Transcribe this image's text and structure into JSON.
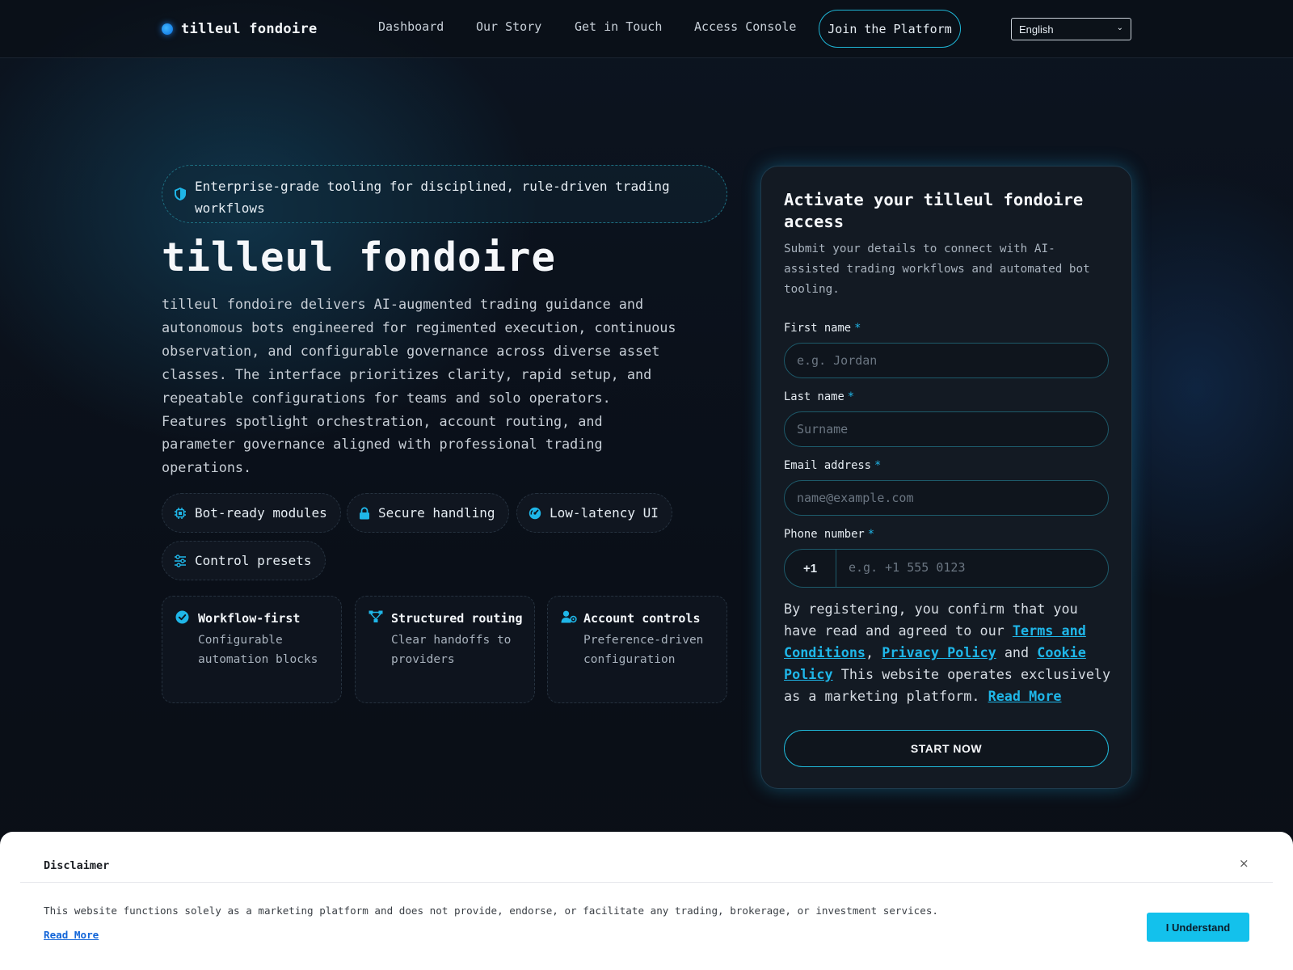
{
  "brand": {
    "name": "tilleul fondoire"
  },
  "nav": {
    "links": [
      "Dashboard",
      "Our Story",
      "Get in Touch",
      "Access Console"
    ],
    "join_label": "Join the Platform",
    "language": "English"
  },
  "hero": {
    "tagline": "Enterprise-grade tooling for disciplined, rule-driven trading workflows",
    "title": "tilleul fondoire",
    "description": "tilleul fondoire delivers AI-augmented trading guidance and autonomous bots engineered for regimented execution, continuous observation, and configurable governance across diverse asset classes. The interface prioritizes clarity, rapid setup, and repeatable configurations for teams and solo operators. Features spotlight orchestration, account routing, and parameter governance aligned with professional trading operations.",
    "pills": [
      {
        "label": "Bot-ready modules",
        "icon": "chip-icon"
      },
      {
        "label": "Secure handling",
        "icon": "lock-icon"
      },
      {
        "label": "Low-latency UI",
        "icon": "gauge-icon"
      },
      {
        "label": "Control presets",
        "icon": "sliders-icon"
      }
    ],
    "cards": [
      {
        "title": "Workflow-first",
        "desc": "Configurable automation blocks",
        "icon": "check-circle-icon"
      },
      {
        "title": "Structured routing",
        "desc": "Clear handoffs to providers",
        "icon": "routing-icon"
      },
      {
        "title": "Account controls",
        "desc": "Preference-driven configuration",
        "icon": "user-settings-icon"
      }
    ]
  },
  "form": {
    "title": "Activate your tilleul fondoire access",
    "subtitle": "Submit your details to connect with AI-assisted trading workflows and automated bot tooling.",
    "required_mark": "*",
    "first_name": {
      "label": "First name",
      "placeholder": "e.g. Jordan"
    },
    "last_name": {
      "label": "Last name",
      "placeholder": "Surname"
    },
    "email": {
      "label": "Email address",
      "placeholder": "name@example.com"
    },
    "phone": {
      "label": "Phone number",
      "code": "+1",
      "placeholder": "e.g. +1 555 0123"
    },
    "consent": {
      "prefix": "By registering, you confirm that you have read and agreed to our ",
      "terms": "Terms and Conditions",
      "sep1": ", ",
      "privacy": "Privacy Policy",
      "sep2": " and ",
      "cookie": "Cookie Policy",
      "middle": " This website operates exclusively as a marketing platform. ",
      "read_more": "Read More"
    },
    "submit": "START NOW"
  },
  "disclaimer": {
    "title": "Disclaimer",
    "close": "×",
    "text": "This website functions solely as a marketing platform and does not provide, endorse, or facilitate any trading, brokerage, or investment services.",
    "read_more": "Read More",
    "button": "I Understand"
  },
  "colors": {
    "accent": "#1fb6e8",
    "background": "#0a0e14",
    "panel": "#131a23",
    "disclaimer_button": "#13c1ec"
  }
}
